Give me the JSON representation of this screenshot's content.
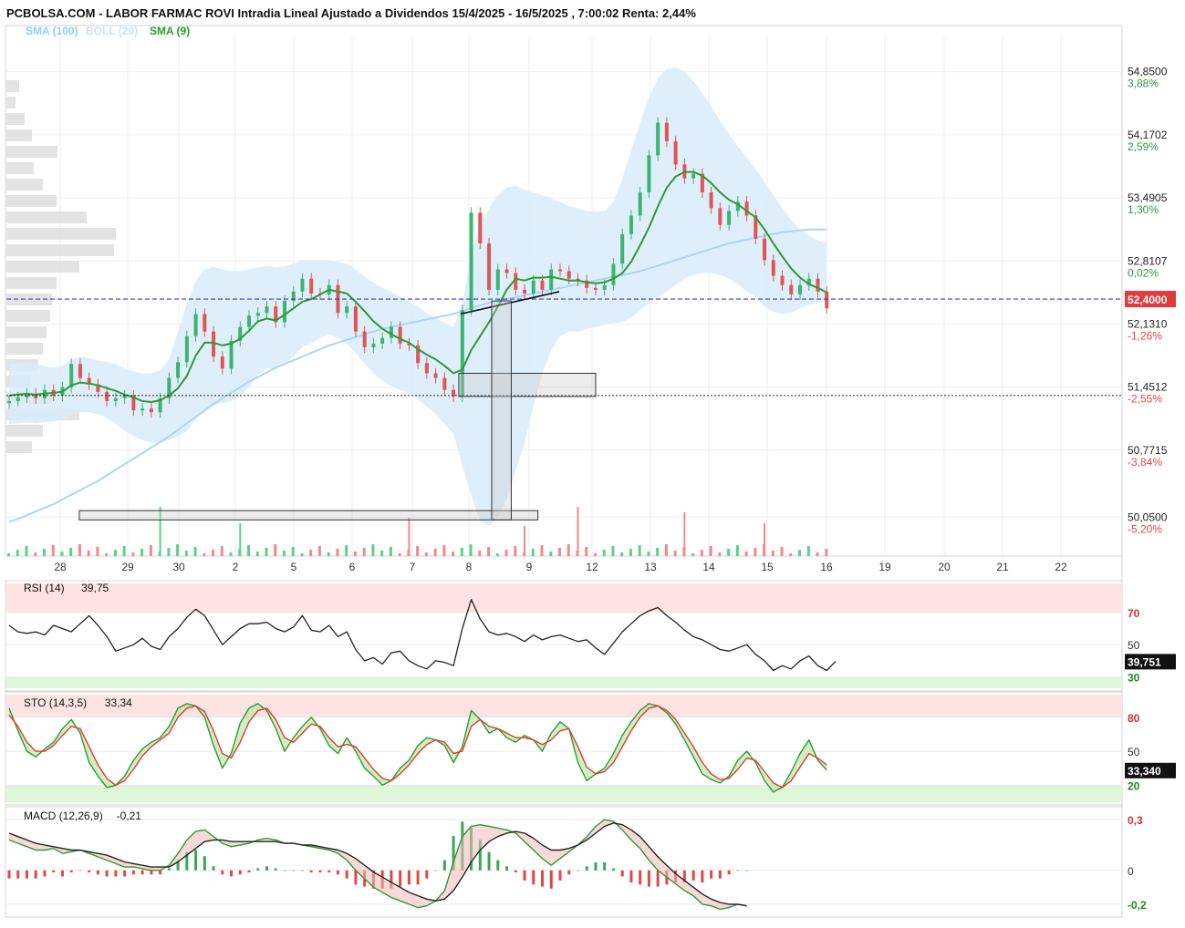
{
  "header": {
    "title": "PCBOLSA.COM - LABOR FARMAC ROVI Intradia Lineal Ajustado a Dividendos 15/4/2025 - 16/5/2025 , 7:00:02 Renta: 2,44%",
    "legend": [
      {
        "label": "SMA (100)",
        "color": "#8fd0ee"
      },
      {
        "label": "BOLL (20)",
        "color": "#cfe3ef"
      },
      {
        "label": "SMA (9)",
        "color": "#2a9a2a"
      }
    ]
  },
  "colors": {
    "up": "#3cb371",
    "down": "#e05555",
    "sma9": "#2f9a2f",
    "sma100": "#a9d8f2",
    "bollinger_fill": "#d8ecfa",
    "last_price_bg": "#e23b3b",
    "rsi_overbought_band": "#fde3e3",
    "rsi_oversold_band": "#dff7d9"
  },
  "chart_data": [
    {
      "type": "line",
      "name": "price",
      "x_ticks": [
        "28",
        "29",
        "30",
        "2",
        "5",
        "6",
        "7",
        "8",
        "9",
        "12",
        "13",
        "14",
        "15",
        "16",
        "19",
        "20",
        "21",
        "22"
      ],
      "y_ticks": [
        {
          "value": 54.85,
          "label": "54,8500",
          "pct": "3,88%"
        },
        {
          "value": 54.1702,
          "label": "54,1702",
          "pct": "2,59%"
        },
        {
          "value": 53.4905,
          "label": "53,4905",
          "pct": "1,30%"
        },
        {
          "value": 52.8107,
          "label": "52,8107",
          "pct": "0,02%"
        },
        {
          "value": 52.131,
          "label": "52,1310",
          "pct": "-1,26%"
        },
        {
          "value": 51.4512,
          "label": "51,4512",
          "pct": "-2,55%"
        },
        {
          "value": 50.7715,
          "label": "50,7715",
          "pct": "-3,84%"
        },
        {
          "value": 50.05,
          "label": "50,0500",
          "pct": "-5,20%"
        }
      ],
      "ylim": [
        49.63,
        55.23
      ],
      "last_price": 52.4,
      "last_price_label": "52,4000",
      "reference_level": 51.36,
      "close_series": [
        51.3,
        51.34,
        51.38,
        51.33,
        51.42,
        51.36,
        51.45,
        51.7,
        51.55,
        51.48,
        51.4,
        51.3,
        51.33,
        51.36,
        51.2,
        51.22,
        51.18,
        51.33,
        51.55,
        51.72,
        52.0,
        52.24,
        52.05,
        51.78,
        51.65,
        51.95,
        52.1,
        52.22,
        52.25,
        52.32,
        52.15,
        52.38,
        52.48,
        52.62,
        52.46,
        52.45,
        52.55,
        52.25,
        52.32,
        52.05,
        51.88,
        51.92,
        51.98,
        52.1,
        51.92,
        51.9,
        51.71,
        51.6,
        51.55,
        51.42,
        51.35,
        52.28,
        53.33,
        53.0,
        52.5,
        52.72,
        52.68,
        52.5,
        52.46,
        52.6,
        52.5,
        52.72,
        52.7,
        52.62,
        52.6,
        52.52,
        52.5,
        52.55,
        52.78,
        53.1,
        53.3,
        53.55,
        53.95,
        54.3,
        54.1,
        53.85,
        53.7,
        53.75,
        53.55,
        53.38,
        53.2,
        53.35,
        53.45,
        53.3,
        53.05,
        52.82,
        52.65,
        52.55,
        52.45,
        52.55,
        52.62,
        52.48,
        52.3
      ],
      "sma9": [
        51.36,
        51.37,
        51.38,
        51.37,
        51.38,
        51.39,
        51.4,
        51.47,
        51.5,
        51.49,
        51.47,
        51.44,
        51.41,
        51.37,
        51.34,
        51.3,
        51.29,
        51.31,
        51.36,
        51.44,
        51.57,
        51.79,
        51.93,
        51.93,
        51.9,
        51.92,
        51.97,
        52.06,
        52.16,
        52.19,
        52.17,
        52.23,
        52.3,
        52.37,
        52.4,
        52.45,
        52.5,
        52.48,
        52.46,
        52.37,
        52.27,
        52.16,
        52.08,
        52.02,
        51.97,
        51.93,
        51.86,
        51.8,
        51.75,
        51.68,
        51.6,
        51.64,
        51.85,
        52.0,
        52.15,
        52.32,
        52.5,
        52.62,
        52.6,
        52.63,
        52.63,
        52.64,
        52.62,
        52.6,
        52.6,
        52.58,
        52.57,
        52.58,
        52.62,
        52.68,
        52.8,
        52.98,
        53.17,
        53.4,
        53.6,
        53.72,
        53.77,
        53.77,
        53.73,
        53.65,
        53.55,
        53.47,
        53.42,
        53.35,
        53.28,
        53.15,
        53.0,
        52.86,
        52.73,
        52.63,
        52.56,
        52.52,
        52.47
      ],
      "sma100": [
        50.0,
        50.03,
        50.07,
        50.11,
        50.15,
        50.19,
        50.24,
        50.29,
        50.34,
        50.39,
        50.44,
        50.5,
        50.56,
        50.62,
        50.68,
        50.74,
        50.8,
        50.86,
        50.92,
        50.99,
        51.06,
        51.13,
        51.2,
        51.27,
        51.33,
        51.39,
        51.45,
        51.51,
        51.56,
        51.61,
        51.66,
        51.7,
        51.74,
        51.78,
        51.82,
        51.86,
        51.9,
        51.93,
        51.96,
        51.99,
        52.02,
        52.05,
        52.08,
        52.1,
        52.12,
        52.14,
        52.16,
        52.18,
        52.2,
        52.22,
        52.24,
        52.27,
        52.3,
        52.33,
        52.36,
        52.38,
        52.4,
        52.42,
        52.44,
        52.46,
        52.48,
        52.5,
        52.52,
        52.54,
        52.56,
        52.58,
        52.6,
        52.62,
        52.64,
        52.66,
        52.68,
        52.7,
        52.73,
        52.76,
        52.79,
        52.82,
        52.85,
        52.88,
        52.91,
        52.94,
        52.97,
        53.0,
        53.02,
        53.04,
        53.06,
        53.08,
        53.1,
        53.12,
        53.13,
        53.14,
        53.15,
        53.15,
        53.15
      ],
      "bollinger_band": {
        "upper": [
          51.7,
          51.7,
          51.72,
          51.7,
          51.68,
          51.66,
          51.68,
          51.75,
          51.78,
          51.76,
          51.74,
          51.72,
          51.7,
          51.66,
          51.62,
          51.6,
          51.6,
          51.63,
          51.75,
          52.05,
          52.35,
          52.6,
          52.72,
          52.75,
          52.72,
          52.7,
          52.7,
          52.72,
          52.74,
          52.76,
          52.74,
          52.75,
          52.78,
          52.82,
          52.82,
          52.82,
          52.82,
          52.8,
          52.78,
          52.72,
          52.64,
          52.58,
          52.52,
          52.48,
          52.42,
          52.38,
          52.32,
          52.25,
          52.2,
          52.14,
          52.1,
          52.35,
          52.9,
          53.2,
          53.38,
          53.52,
          53.6,
          53.62,
          53.58,
          53.55,
          53.52,
          53.48,
          53.45,
          53.4,
          53.38,
          53.35,
          53.34,
          53.35,
          53.45,
          53.7,
          54.0,
          54.3,
          54.58,
          54.78,
          54.88,
          54.9,
          54.85,
          54.75,
          54.62,
          54.48,
          54.32,
          54.18,
          54.05,
          53.92,
          53.8,
          53.67,
          53.52,
          53.38,
          53.25,
          53.15,
          53.08,
          53.03,
          53.0
        ],
        "lower": [
          51.05,
          51.06,
          51.07,
          51.06,
          51.07,
          51.08,
          51.1,
          51.15,
          51.18,
          51.18,
          51.16,
          51.12,
          51.05,
          50.98,
          50.92,
          50.88,
          50.85,
          50.85,
          50.88,
          50.92,
          50.98,
          51.1,
          51.2,
          51.25,
          51.28,
          51.3,
          51.35,
          51.45,
          51.58,
          51.65,
          51.65,
          51.7,
          51.78,
          51.88,
          51.92,
          51.98,
          52.02,
          51.98,
          51.92,
          51.82,
          51.7,
          51.6,
          51.52,
          51.46,
          51.42,
          51.38,
          51.32,
          51.24,
          51.16,
          51.05,
          50.95,
          50.6,
          50.28,
          50.0,
          49.95,
          50.05,
          50.25,
          50.55,
          50.85,
          51.25,
          51.6,
          51.85,
          52.0,
          52.05,
          52.05,
          52.08,
          52.1,
          52.12,
          52.14,
          52.15,
          52.2,
          52.28,
          52.35,
          52.42,
          52.48,
          52.55,
          52.62,
          52.66,
          52.68,
          52.68,
          52.66,
          52.62,
          52.56,
          52.48,
          52.42,
          52.32,
          52.26,
          52.24,
          52.25,
          52.3,
          52.34,
          52.36,
          52.38
        ]
      },
      "volume_spikes": {
        "tall_positions": [
          17,
          26,
          45,
          58,
          64,
          76,
          85
        ],
        "tall_values": [
          0.9,
          0.6,
          0.7,
          0.55,
          0.9,
          0.8,
          0.6
        ]
      },
      "annotations": [
        {
          "type": "trendline",
          "from": [
            50.8,
            52.24
          ],
          "to": [
            61.9,
            52.48
          ]
        },
        {
          "type": "box",
          "x0": 50.6,
          "x1": 66.0,
          "y0": 51.35,
          "y1": 51.6
        },
        {
          "type": "box",
          "x0": 7.9,
          "x1": 59.5,
          "y0": 50.02,
          "y1": 50.12
        },
        {
          "type": "box",
          "x0": 54.3,
          "x1": 56.5,
          "y0": 50.02,
          "y1": 52.38
        }
      ]
    },
    {
      "type": "line",
      "name": "RSI",
      "label": "RSI (14)",
      "last_value_text": "39,75",
      "last_label": "39,751",
      "levels": [
        {
          "value": 70,
          "label": "70"
        },
        {
          "value": 50,
          "label": "50"
        },
        {
          "value": 30,
          "label": "30"
        }
      ],
      "ylim": [
        23,
        88
      ],
      "overbought_band": [
        70,
        88
      ],
      "oversold_band": [
        23,
        30
      ],
      "values": [
        62,
        58,
        57,
        58,
        56,
        62,
        60,
        58,
        63,
        68,
        62,
        55,
        46,
        48,
        50,
        54,
        49,
        47,
        55,
        60,
        67,
        72,
        68,
        59,
        50,
        55,
        60,
        63,
        63,
        64,
        60,
        58,
        61,
        68,
        59,
        58,
        62,
        55,
        58,
        47,
        40,
        42,
        38,
        45,
        46,
        40,
        37,
        35,
        40,
        39,
        37,
        60,
        78,
        66,
        58,
        56,
        57,
        55,
        52,
        56,
        53,
        55,
        56,
        54,
        52,
        53,
        48,
        44,
        51,
        58,
        63,
        68,
        71,
        73,
        68,
        64,
        59,
        55,
        53,
        50,
        47,
        46,
        48,
        50,
        44,
        40,
        34,
        37,
        35,
        40,
        43,
        37,
        34,
        39.75
      ]
    },
    {
      "type": "line",
      "name": "STO",
      "label": "STO (14,3,5)",
      "last_value_text": "33,34",
      "last_label": "33,340",
      "levels": [
        {
          "value": 80,
          "label": "80"
        },
        {
          "value": 50,
          "label": "50"
        },
        {
          "value": 20,
          "label": "20"
        }
      ],
      "ylim": [
        5,
        100
      ],
      "overbought_band": [
        80,
        100
      ],
      "oversold_band": [
        5,
        20
      ],
      "k_values": [
        88,
        68,
        50,
        45,
        52,
        58,
        70,
        78,
        66,
        40,
        28,
        18,
        20,
        28,
        42,
        52,
        58,
        62,
        72,
        88,
        92,
        90,
        80,
        55,
        35,
        48,
        75,
        88,
        92,
        86,
        70,
        50,
        62,
        72,
        80,
        70,
        55,
        48,
        62,
        50,
        35,
        28,
        20,
        24,
        35,
        42,
        55,
        62,
        60,
        55,
        40,
        54,
        86,
        78,
        66,
        70,
        62,
        58,
        64,
        60,
        50,
        66,
        76,
        70,
        40,
        24,
        30,
        35,
        48,
        64,
        76,
        86,
        92,
        90,
        84,
        74,
        60,
        45,
        30,
        25,
        22,
        28,
        42,
        50,
        40,
        24,
        14,
        18,
        32,
        48,
        60,
        42,
        33.34
      ],
      "d_values": [
        82,
        72,
        58,
        50,
        50,
        55,
        64,
        72,
        70,
        54,
        38,
        26,
        20,
        24,
        34,
        46,
        54,
        60,
        66,
        80,
        88,
        90,
        85,
        68,
        48,
        44,
        58,
        76,
        86,
        88,
        78,
        62,
        58,
        66,
        74,
        72,
        62,
        54,
        56,
        54,
        44,
        34,
        26,
        24,
        30,
        38,
        48,
        56,
        60,
        58,
        48,
        50,
        72,
        78,
        72,
        70,
        66,
        62,
        62,
        60,
        56,
        60,
        68,
        70,
        54,
        36,
        30,
        32,
        40,
        54,
        68,
        80,
        88,
        90,
        86,
        78,
        66,
        54,
        40,
        30,
        25,
        26,
        34,
        44,
        42,
        32,
        22,
        18,
        24,
        36,
        48,
        44,
        38
      ]
    },
    {
      "type": "line",
      "name": "MACD",
      "label": "MACD (12,26,9)",
      "last_value_text": "-0,21",
      "levels": [
        {
          "value": 0.3,
          "label": "0,3"
        },
        {
          "value": 0,
          "label": "0"
        },
        {
          "value": -0.2,
          "label": "-0,2"
        }
      ],
      "ylim": [
        -0.26,
        0.36
      ],
      "macd": [
        0.18,
        0.16,
        0.14,
        0.12,
        0.12,
        0.13,
        0.1,
        0.11,
        0.12,
        0.1,
        0.08,
        0.06,
        0.04,
        0.02,
        0.02,
        0.01,
        0.0,
        0.0,
        0.03,
        0.1,
        0.18,
        0.23,
        0.24,
        0.2,
        0.16,
        0.14,
        0.15,
        0.16,
        0.18,
        0.19,
        0.18,
        0.16,
        0.16,
        0.15,
        0.14,
        0.13,
        0.12,
        0.1,
        0.06,
        0.0,
        -0.05,
        -0.1,
        -0.13,
        -0.16,
        -0.18,
        -0.2,
        -0.22,
        -0.21,
        -0.18,
        -0.12,
        0.05,
        0.2,
        0.26,
        0.27,
        0.26,
        0.25,
        0.24,
        0.22,
        0.17,
        0.12,
        0.07,
        0.03,
        0.07,
        0.11,
        0.15,
        0.2,
        0.26,
        0.3,
        0.29,
        0.24,
        0.18,
        0.13,
        0.06,
        0.0,
        -0.04,
        -0.08,
        -0.12,
        -0.15,
        -0.2,
        -0.21,
        -0.23,
        -0.22,
        -0.2,
        -0.21
      ],
      "signal": [
        0.22,
        0.2,
        0.18,
        0.16,
        0.15,
        0.14,
        0.13,
        0.12,
        0.12,
        0.11,
        0.1,
        0.09,
        0.07,
        0.05,
        0.04,
        0.03,
        0.02,
        0.02,
        0.02,
        0.05,
        0.09,
        0.13,
        0.17,
        0.18,
        0.18,
        0.17,
        0.17,
        0.17,
        0.17,
        0.17,
        0.17,
        0.16,
        0.16,
        0.15,
        0.15,
        0.14,
        0.13,
        0.12,
        0.1,
        0.07,
        0.03,
        -0.01,
        -0.04,
        -0.07,
        -0.1,
        -0.13,
        -0.15,
        -0.17,
        -0.18,
        -0.17,
        -0.12,
        -0.04,
        0.05,
        0.12,
        0.17,
        0.2,
        0.22,
        0.23,
        0.22,
        0.19,
        0.15,
        0.12,
        0.12,
        0.13,
        0.15,
        0.18,
        0.22,
        0.26,
        0.28,
        0.27,
        0.24,
        0.2,
        0.14,
        0.08,
        0.03,
        -0.02,
        -0.06,
        -0.1,
        -0.14,
        -0.17,
        -0.19,
        -0.2,
        -0.2,
        -0.21
      ]
    }
  ]
}
